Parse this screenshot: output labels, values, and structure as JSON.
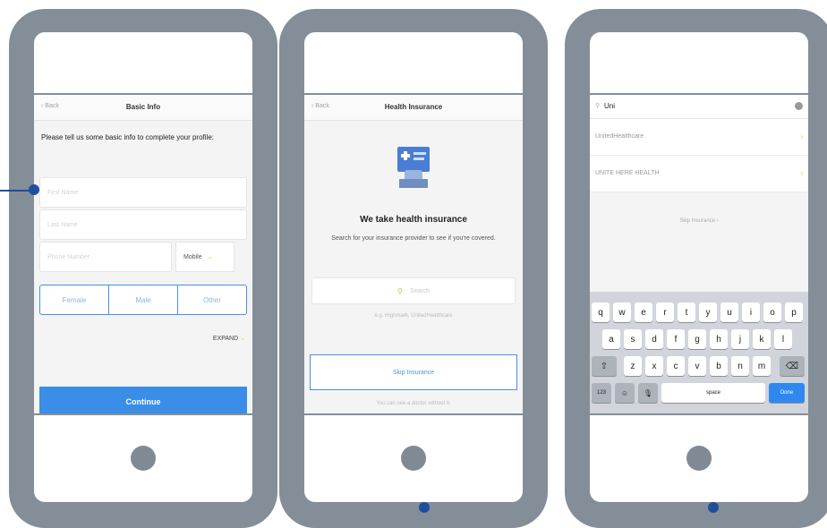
{
  "colors": {
    "phone": "#848e98",
    "accent_blue": "#3a8ee8",
    "accent_yellow": "#f5c34b",
    "marker": "#1f4f9c"
  },
  "phone1": {
    "back": "‹ Back",
    "title": "Basic Info",
    "intro": "Please tell us some basic info to complete your profile:",
    "first_name_ph": "First Name",
    "last_name_ph": "Last Name",
    "phone_ph": "Phone Number",
    "phone_type": "Mobile",
    "chevron": "⌄",
    "sex": [
      "Female",
      "Male",
      "Other"
    ],
    "expand": "EXPAND",
    "continue": "Continue"
  },
  "phone2": {
    "back": "‹ Back",
    "title": "Health Insurance",
    "heading": "We take health insurance",
    "subtitle": "Search for your insurance provider to see if you're covered.",
    "search_ph": "Search",
    "example": "e.g. Highmark, UnitedHealthcare",
    "skip": "Skip Insurance",
    "without": "You can see a doctor without it."
  },
  "phone3": {
    "query": "Uni",
    "results": [
      "UnitedHealthcare",
      "UNITE HERE HEALTH"
    ],
    "result_chevron": "›",
    "skip": "Skip Insurance ›",
    "keys_row1": [
      "q",
      "w",
      "e",
      "r",
      "t",
      "y",
      "u",
      "i",
      "o",
      "p"
    ],
    "keys_row2": [
      "a",
      "s",
      "d",
      "f",
      "g",
      "h",
      "j",
      "k",
      "l"
    ],
    "keys_row3": [
      "z",
      "x",
      "c",
      "v",
      "b",
      "n",
      "m"
    ],
    "shift": "⇧",
    "backspace": "⌫",
    "num_key": "123",
    "emoji_key": "☺",
    "mic_key": "🎙",
    "space": "space",
    "done": "Done"
  },
  "icons": [
    "insurance-card-icon",
    "search-icon",
    "clear-icon",
    "chevron-right-icon",
    "chevron-down-icon",
    "shift-icon",
    "backspace-icon",
    "emoji-icon",
    "mic-icon"
  ]
}
